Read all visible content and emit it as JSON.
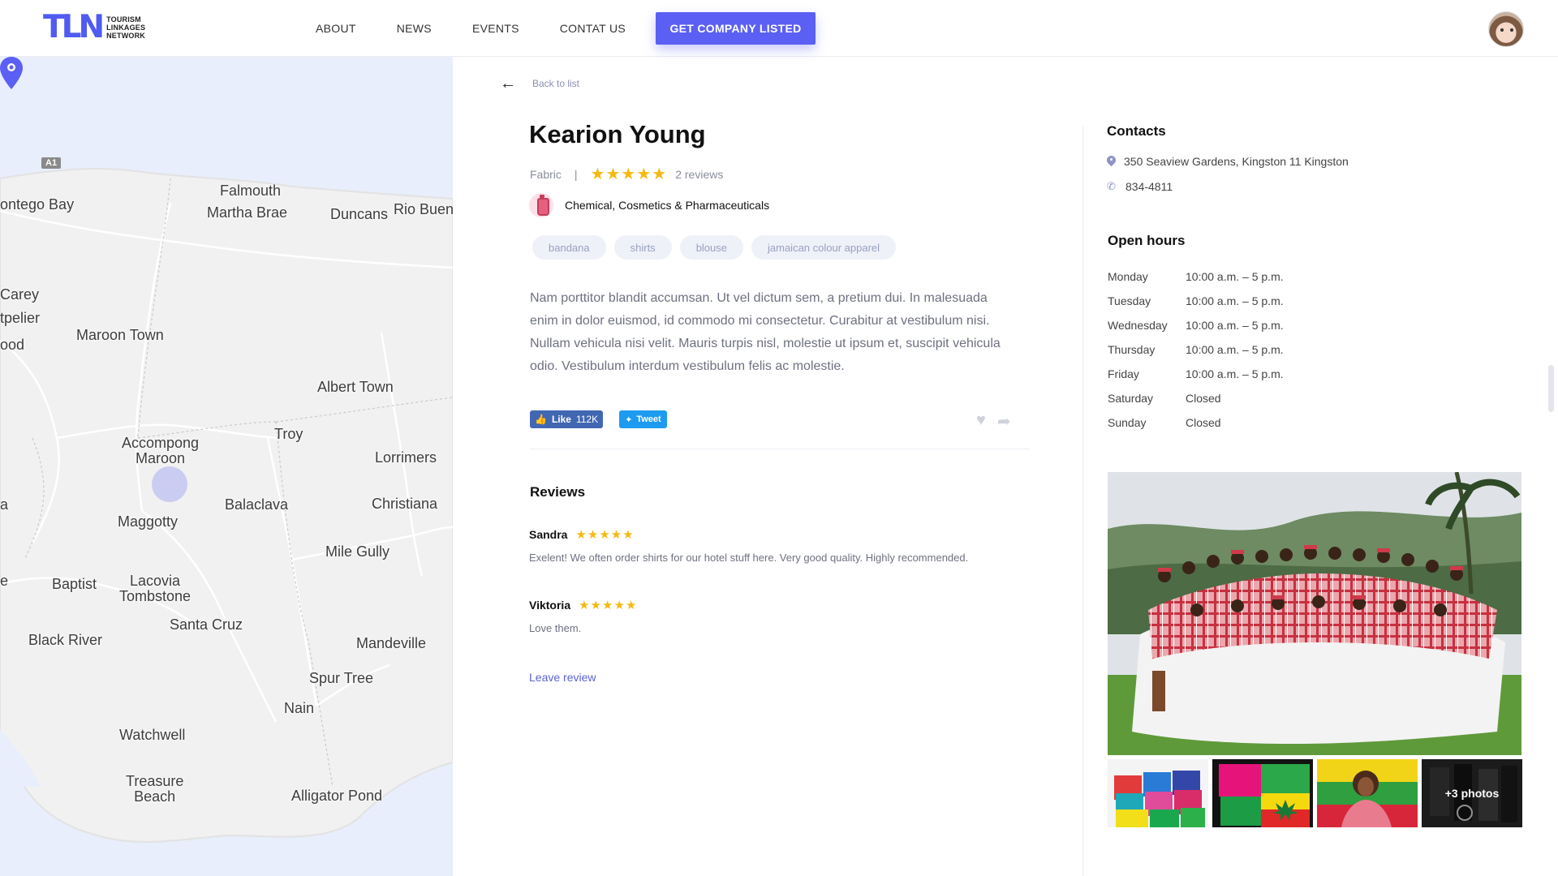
{
  "header": {
    "logo_mark": "TLN",
    "logo_text": [
      "TOURISM",
      "LINKAGES",
      "NETWORK"
    ],
    "nav": [
      "ABOUT",
      "NEWS",
      "EVENTS",
      "CONTAT US"
    ],
    "cta_label": "GET COMPANY LISTED",
    "accent_color": "#5b5ff3"
  },
  "map": {
    "road_badge": "A1",
    "places": {
      "montego_bay": "ontego Bay",
      "falmouth": "Falmouth",
      "martha_brae": "Martha Brae",
      "duncans": "Duncans",
      "rio_bueno": "Rio Buen",
      "carey": "Carey",
      "montpelier": "tpelier",
      "wood": "ood",
      "maroon_town": "Maroon Town",
      "albert_town": "Albert Town",
      "troy": "Troy",
      "accompong_1": "Accompong",
      "accompong_2": "Maroon",
      "lorrimers": "Lorrimers",
      "la": "a",
      "balaclava": "Balaclava",
      "christiana": "Christiana",
      "maggotty": "Maggotty",
      "mile_gully": "Mile Gully",
      "e": "e",
      "baptist": "Baptist",
      "lacovia_1": "Lacovia",
      "lacovia_2": "Tombstone",
      "santa_cruz": "Santa Cruz",
      "black_river": "Black River",
      "mandeville": "Mandeville",
      "spur_tree": "Spur Tree",
      "nain": "Nain",
      "watchwell": "Watchwell",
      "treasure_1": "Treasure",
      "treasure_2": "Beach",
      "alligator_pond": "Alligator Pond"
    }
  },
  "detail": {
    "back_label": "Back to list",
    "title": "Kearion Young",
    "category": "Fabric",
    "separator": "|",
    "rating_stars": "★★★★★",
    "reviews_count": "2 reviews",
    "industry": "Chemical, Cosmetics & Pharmaceuticals",
    "tags": [
      "bandana",
      "shirts",
      "blouse",
      "jamaican colour apparel"
    ],
    "description": "Nam porttitor blandit accumsan. Ut vel dictum sem, a pretium dui. In malesuada enim in dolor euismod, id commodo mi consectetur. Curabitur at vestibulum nisi. Nullam vehicula nisi velit. Mauris turpis nisl, molestie ut ipsum et, suscipit vehicula odio. Vestibulum interdum vestibulum felis ac molestie.",
    "fb_like": "Like",
    "fb_count": "112K",
    "tweet": "Tweet",
    "reviews_title": "Reviews",
    "reviews": [
      {
        "name": "Sandra",
        "stars": "★★★★★",
        "text": "Exelent! We often order shirts for our hotel stuff here. Very good quality. Highly recommended."
      },
      {
        "name": "Viktoria",
        "stars": "★★★★★",
        "text": "Love them."
      }
    ],
    "leave_review": "Leave review"
  },
  "sidebar": {
    "contacts_title": "Contacts",
    "address": "350 Seaview Gardens, Kingston 11 Kingston",
    "phone": "834-4811",
    "hours_title": "Open hours",
    "hours": [
      {
        "day": "Monday",
        "time": "10:00 a.m. – 5 p.m."
      },
      {
        "day": "Tuesday",
        "time": "10:00 a.m. – 5 p.m."
      },
      {
        "day": "Wednesday",
        "time": "10:00 a.m. – 5 p.m."
      },
      {
        "day": "Thursday",
        "time": "10:00 a.m. – 5 p.m."
      },
      {
        "day": "Friday",
        "time": "10:00 a.m. – 5 p.m."
      },
      {
        "day": "Saturday",
        "time": "Closed"
      },
      {
        "day": "Sunday",
        "time": "Closed"
      }
    ],
    "more_photos": "+3 photos"
  }
}
